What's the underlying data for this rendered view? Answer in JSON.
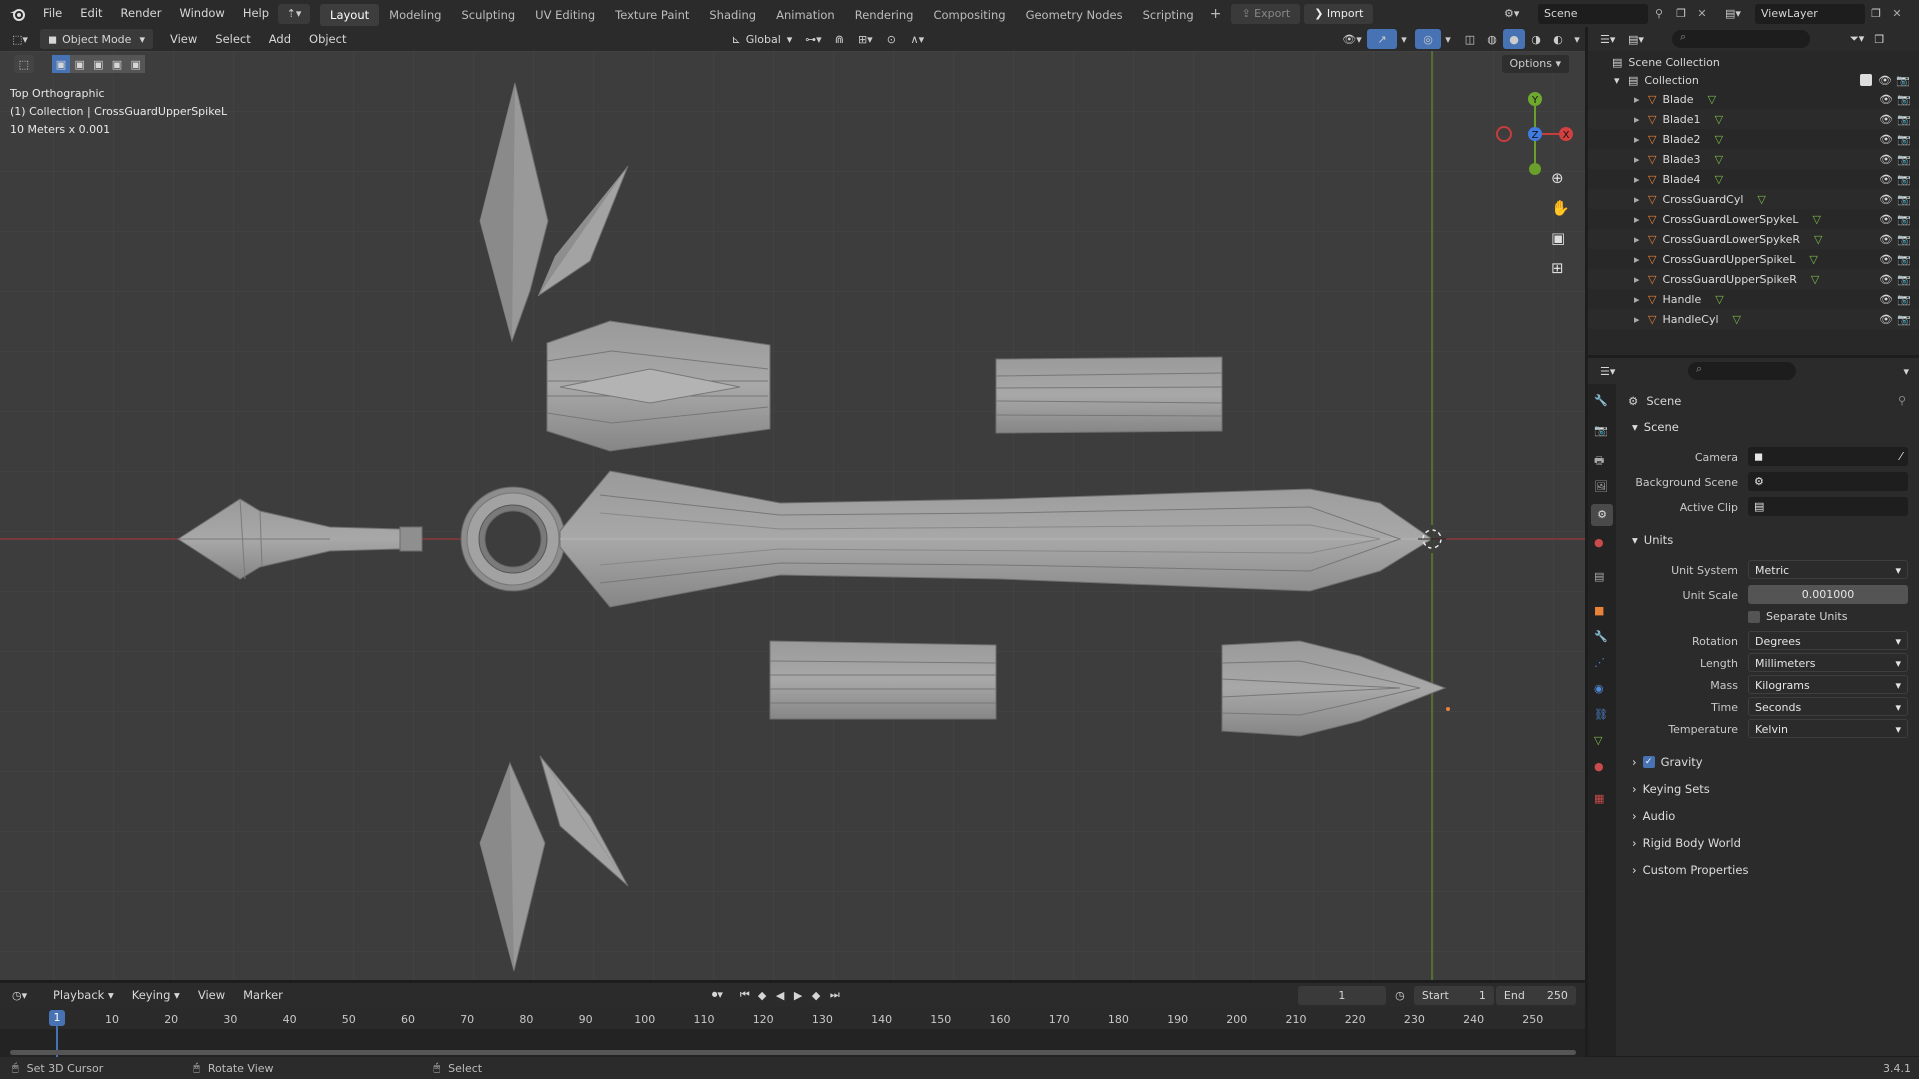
{
  "topbar": {
    "menus": [
      "File",
      "Edit",
      "Render",
      "Window",
      "Help"
    ],
    "workspaces": [
      "Layout",
      "Modeling",
      "Sculpting",
      "UV Editing",
      "Texture Paint",
      "Shading",
      "Animation",
      "Rendering",
      "Compositing",
      "Geometry Nodes",
      "Scripting"
    ],
    "active_workspace": "Layout",
    "export_label": "Export",
    "import_label": "Import",
    "scene_name": "Scene",
    "view_layer": "ViewLayer"
  },
  "viewport_header": {
    "mode": "Object Mode",
    "menus": [
      "View",
      "Select",
      "Add",
      "Object"
    ],
    "orientation": "Global",
    "options_label": "Options"
  },
  "viewport_overlay": {
    "view_name": "Top Orthographic",
    "collection_info": "(1) Collection | CrossGuardUpperSpikeL",
    "scale_info": "10 Meters x 0.001"
  },
  "gizmo": {
    "x": "X",
    "y": "Y",
    "z": "Z"
  },
  "outliner": {
    "root": "Scene Collection",
    "collection": "Collection",
    "objects": [
      "Blade",
      "Blade1",
      "Blade2",
      "Blade3",
      "Blade4",
      "CrossGuardCyl",
      "CrossGuardLowerSpykeL",
      "CrossGuardLowerSpykeR",
      "CrossGuardUpperSpikeL",
      "CrossGuardUpperSpikeR",
      "Handle",
      "HandleCyl"
    ]
  },
  "properties": {
    "context_title": "Scene",
    "scene_panel_title": "Scene",
    "camera_label": "Camera",
    "background_scene_label": "Background Scene",
    "active_clip_label": "Active Clip",
    "units_panel_title": "Units",
    "unit_system_label": "Unit System",
    "unit_system_value": "Metric",
    "unit_scale_label": "Unit Scale",
    "unit_scale_value": "0.001000",
    "separate_units_label": "Separate Units",
    "rotation_label": "Rotation",
    "rotation_value": "Degrees",
    "length_label": "Length",
    "length_value": "Millimeters",
    "mass_label": "Mass",
    "mass_value": "Kilograms",
    "time_label": "Time",
    "time_value": "Seconds",
    "temperature_label": "Temperature",
    "temperature_value": "Kelvin",
    "gravity_label": "Gravity",
    "keying_sets_label": "Keying Sets",
    "audio_label": "Audio",
    "rigid_body_label": "Rigid Body World",
    "custom_props_label": "Custom Properties"
  },
  "timeline": {
    "menus": [
      "Playback",
      "Keying",
      "View",
      "Marker"
    ],
    "current_frame": "1",
    "start_label": "Start",
    "start_value": "1",
    "end_label": "End",
    "end_value": "250",
    "ticks": [
      "10",
      "20",
      "30",
      "40",
      "50",
      "60",
      "70",
      "80",
      "90",
      "100",
      "110",
      "120",
      "130",
      "140",
      "150",
      "160",
      "170",
      "180",
      "190",
      "200",
      "210",
      "220",
      "230",
      "240",
      "250"
    ],
    "playhead_label": "1"
  },
  "statusbar": {
    "hint1": "Set 3D Cursor",
    "hint2": "Rotate View",
    "hint3": "Select",
    "version": "3.4.1"
  },
  "colors": {
    "accent": "#4772b3",
    "object_orange": "#e8833a",
    "mesh_green": "#7dbd4b",
    "axis_red": "#c83c3c",
    "axis_green": "#6a9f2a"
  }
}
